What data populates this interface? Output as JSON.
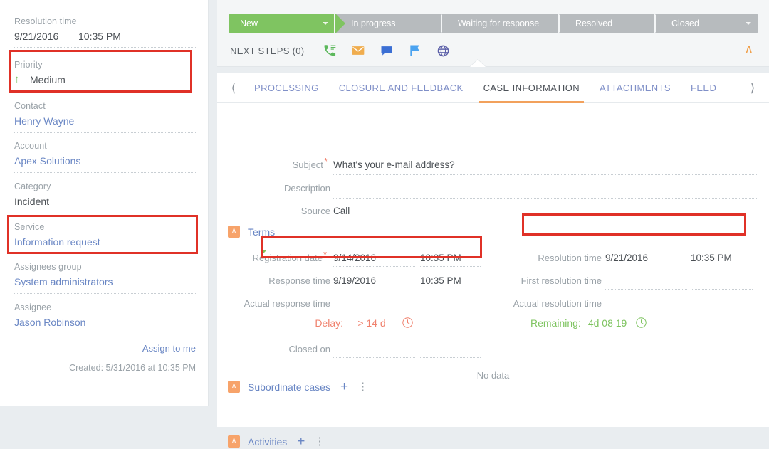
{
  "sidebar": {
    "resolution_time": {
      "label": "Resolution time",
      "date": "9/21/2016",
      "time": "10:35 PM"
    },
    "priority": {
      "label": "Priority",
      "value": "Medium",
      "arrow": "up-arrow-icon"
    },
    "contact": {
      "label": "Contact",
      "value": "Henry Wayne"
    },
    "account": {
      "label": "Account",
      "value": "Apex Solutions"
    },
    "category": {
      "label": "Category",
      "value": "Incident"
    },
    "service": {
      "label": "Service",
      "value": "Information request"
    },
    "assignees_group": {
      "label": "Assignees group",
      "value": "System administrators"
    },
    "assignee": {
      "label": "Assignee",
      "value": "Jason Robinson"
    },
    "assign_to_me": "Assign to me",
    "created": "Created: 5/31/2016 at 10:35 PM"
  },
  "stages": [
    {
      "label": "New",
      "active": true,
      "caret": true
    },
    {
      "label": "In progress",
      "active": false,
      "caret": false
    },
    {
      "label": "Waiting for response",
      "active": false,
      "caret": false
    },
    {
      "label": "Resolved",
      "active": false,
      "caret": false
    },
    {
      "label": "Closed",
      "active": false,
      "caret": true
    }
  ],
  "next_steps": {
    "label": "NEXT STEPS (0)",
    "icons": [
      {
        "name": "phone-call-icon",
        "color": "#5cb85c"
      },
      {
        "name": "email-icon",
        "color": "#f0ad4e"
      },
      {
        "name": "chat-message-icon",
        "color": "#3b6fd4"
      },
      {
        "name": "flag-icon",
        "color": "#4aa3f0"
      },
      {
        "name": "globe-icon",
        "color": "#5b5fa8"
      }
    ],
    "collapse": "chevron-up-icon"
  },
  "tabs": [
    {
      "label": "PROCESSING",
      "active": false
    },
    {
      "label": "CLOSURE AND FEEDBACK",
      "active": false
    },
    {
      "label": "CASE INFORMATION",
      "active": true
    },
    {
      "label": "ATTACHMENTS",
      "active": false
    },
    {
      "label": "FEED",
      "active": false
    }
  ],
  "form": {
    "subject": {
      "label": "Subject",
      "required": true,
      "value": "What's your e-mail address?"
    },
    "description": {
      "label": "Description",
      "required": false,
      "value": ""
    },
    "source": {
      "label": "Source",
      "required": false,
      "value": "Call"
    }
  },
  "terms": {
    "title": "Terms",
    "registration_date": {
      "label": "Registration date",
      "required": true,
      "date": "9/14/2016",
      "time": "10:35 PM"
    },
    "response_time": {
      "label": "Response time",
      "required": false,
      "date": "9/19/2016",
      "time": "10:35 PM"
    },
    "actual_response_time": {
      "label": "Actual response time",
      "date": "",
      "time": ""
    },
    "closed_on": {
      "label": "Closed on",
      "date": "",
      "time": ""
    },
    "resolution_time": {
      "label": "Resolution time",
      "date": "9/21/2016",
      "time": "10:35 PM"
    },
    "first_resolution_time": {
      "label": "First resolution time",
      "date": "",
      "time": ""
    },
    "actual_resolution_time": {
      "label": "Actual resolution time",
      "date": "",
      "time": ""
    },
    "delay": {
      "label": "Delay:",
      "value": "> 14 d",
      "color": "#f0826e",
      "icon": "clock-icon"
    },
    "remaining": {
      "label": "Remaining:",
      "value": "4d 08 19",
      "color": "#7fc461",
      "icon": "clock-icon"
    }
  },
  "subordinate_cases": {
    "title": "Subordinate cases",
    "empty_text": "No data"
  },
  "activities": {
    "title": "Activities"
  },
  "colors": {
    "accent_orange": "#f2a15c",
    "link_blue": "#6986c4",
    "stage_active_green": "#7fc461",
    "stage_inactive_grey": "#b7bbbe",
    "annotation_red": "#e03127"
  }
}
